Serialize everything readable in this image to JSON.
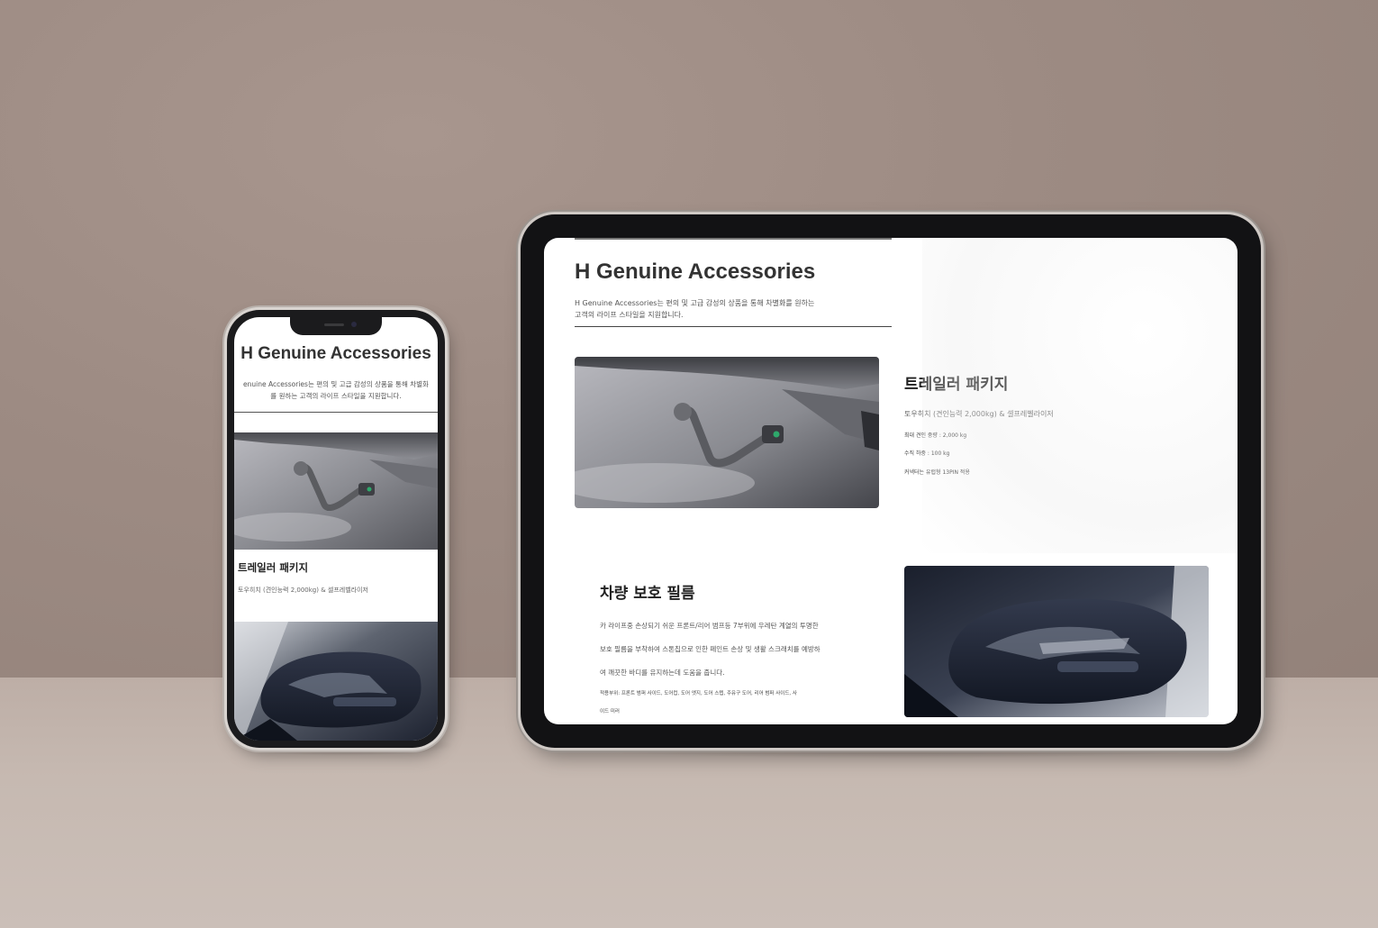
{
  "page": {
    "title": "H Genuine Accessories",
    "description_line1": "H Genuine Accessories는 편의 및 고급 감성의 상품을 통해 차별화를 원하는",
    "description_line2": "고객의 라이프 스타일을 지원합니다."
  },
  "phone": {
    "title": "H Genuine Accessories",
    "description_line1": "enuine Accessories는 편의 및 고급 감성의 상품을 통해 차별화",
    "description_line2": "를 원하는 고객의 라이프 스타일을 지원합니다.",
    "section_title": "트레일러 패키지",
    "section_subtitle": "토우히치 (견인능력 2,000kg) & 셀프레벨라이저"
  },
  "trailer_package": {
    "title": "트레일러 패키지",
    "subtitle": "토우히치 (견인능력 2,000kg) & 셀프레벨라이저",
    "details": [
      "최대 견인 중량 : 2,000 kg",
      "수직 하중 : 100 kg",
      "커넥터는 유럽형 13PIN 적용"
    ]
  },
  "protection_film": {
    "title": "차량 보호 필름",
    "body_lines": [
      "카 라이프중 손상되기 쉬운 프론트/리어 범프등 7부위에 우레탄 계열의 투명한",
      "보호 필름을 부착하여 스톤칩으로 인한 페인트 손상 및 생활 스크래치를 예방하",
      "여 깨끗한 바디를 유지하는데 도움을 줍니다."
    ],
    "apply_line1": "적용부위: 프론트 범퍼 사이드, 도어컵, 도어 엣지, 도어 스텝, 주유구 도어, 리어 범퍼 사이드, 사",
    "apply_line2": "이드 미러"
  },
  "colors": {
    "wall": "#9c8c84",
    "floor": "#c6b9b1",
    "device_frame": "#1b1b1d",
    "screen_bg": "#ffffff",
    "heading": "#333333"
  },
  "icons": {
    "tow_hitch_image": "tow-hitch-photo",
    "side_mirror_image": "side-mirror-photo"
  }
}
